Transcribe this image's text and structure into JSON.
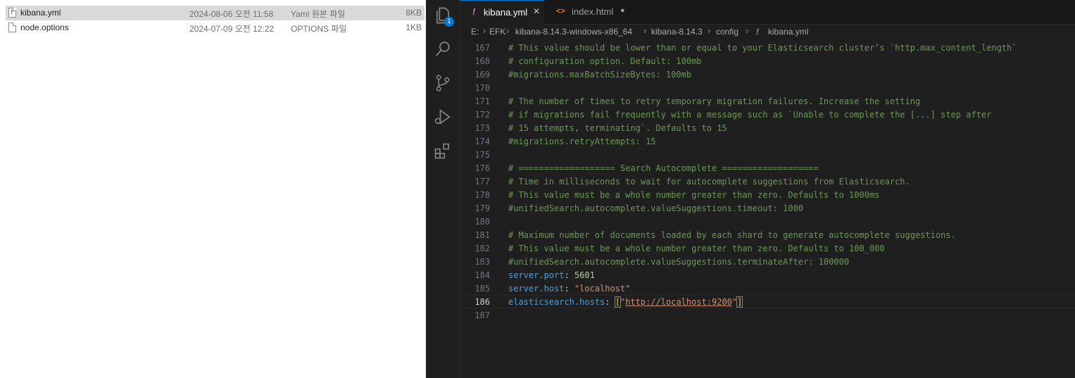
{
  "explorer": {
    "files": [
      {
        "name": "kibana.yml",
        "date": "2024-08-06 오전 11:58",
        "type": "Yaml 원본 파일",
        "size": "8KB",
        "selected": true
      },
      {
        "name": "node.options",
        "date": "2024-07-09 오전 12:22",
        "type": "OPTIONS 파일",
        "size": "1KB",
        "selected": false
      }
    ]
  },
  "vscode": {
    "activity_badge": "1",
    "icons": [
      "explorer-icon",
      "search-icon",
      "source-control-icon",
      "run-debug-icon",
      "extensions-icon"
    ],
    "tabs": [
      {
        "icon": "!",
        "label": "kibana.yml",
        "control": "✕",
        "active": true
      },
      {
        "icon": "<>",
        "label": "index.html",
        "control": "●",
        "active": false
      }
    ],
    "breadcrumb": [
      "E:",
      "EFK",
      "kibana-8.14.3-windows-x86_64",
      "kibana-8.14.3",
      "config",
      "kibana.yml"
    ],
    "breadcrumb_file_icon": "!",
    "colors": {
      "comment": "#6a9955",
      "key": "#569cd6",
      "number": "#b5cea8",
      "string": "#ce9178",
      "accent": "#0078d4"
    },
    "lines": [
      {
        "n": "167",
        "comment": "# This value should be lower than or equal to your Elasticsearch cluster’s `http.max_content_length`"
      },
      {
        "n": "168",
        "comment": "# configuration option. Default: 100mb"
      },
      {
        "n": "169",
        "comment": "#migrations.maxBatchSizeBytes: 100mb"
      },
      {
        "n": "170",
        "comment": ""
      },
      {
        "n": "171",
        "comment": "# The number of times to retry temporary migration failures. Increase the setting"
      },
      {
        "n": "172",
        "comment": "# if migrations fail frequently with a message such as `Unable to complete the [...] step after"
      },
      {
        "n": "173",
        "comment": "# 15 attempts, terminating`. Defaults to 15"
      },
      {
        "n": "174",
        "comment": "#migrations.retryAttempts: 15"
      },
      {
        "n": "175",
        "comment": ""
      },
      {
        "n": "176",
        "comment": "# =================== Search Autocomplete ==================="
      },
      {
        "n": "177",
        "comment": "# Time in milliseconds to wait for autocomplete suggestions from Elasticsearch."
      },
      {
        "n": "178",
        "comment": "# This value must be a whole number greater than zero. Defaults to 1000ms"
      },
      {
        "n": "179",
        "comment": "#unifiedSearch.autocomplete.valueSuggestions.timeout: 1000"
      },
      {
        "n": "180",
        "comment": ""
      },
      {
        "n": "181",
        "comment": "# Maximum number of documents loaded by each shard to generate autocomplete suggestions."
      },
      {
        "n": "182",
        "comment": "# This value must be a whole number greater than zero. Defaults to 100_000"
      },
      {
        "n": "183",
        "comment": "#unifiedSearch.autocomplete.valueSuggestions.terminateAfter: 100000"
      }
    ],
    "config_lines": {
      "port": {
        "n": "184",
        "key": "server.port",
        "colon": ": ",
        "value": "5601"
      },
      "host": {
        "n": "185",
        "key": "server.host",
        "colon": ": ",
        "value": "\"localhost\""
      },
      "es": {
        "n": "186",
        "key": "elasticsearch.hosts",
        "colon": ": ",
        "open": "[",
        "q1": "\"",
        "url": "http://localhost:9200",
        "q2": "\"",
        "close": "]"
      },
      "last": {
        "n": "187"
      }
    }
  }
}
